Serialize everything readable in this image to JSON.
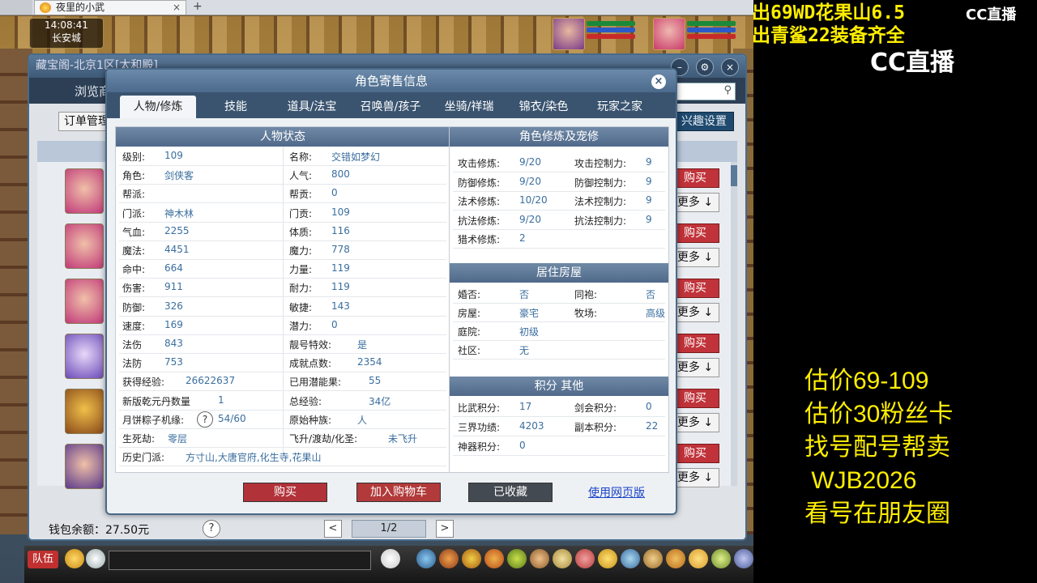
{
  "browser": {
    "tab_title": "夜里的小武",
    "tab_close": "×",
    "new_tab": "+"
  },
  "clock": {
    "time": "14:08:41",
    "location": "长安城"
  },
  "overlay": {
    "line1": "出69WD花果山6.5",
    "line2": "出青鲨22装备齐全",
    "cc_small": "CC直播",
    "cc_large": "CC直播",
    "right_lines": [
      "估价69-109",
      "估价30粉丝卡",
      "找号配号帮卖",
      " WJB2026",
      "看号在朋友圈"
    ]
  },
  "shop": {
    "title": "藏宝阁-北京1区[太和殿]",
    "nav_browse": "浏览商",
    "order_button": "订单管理",
    "interest_button": "兴趣设置",
    "buy_label": "购买",
    "more_label": "更多 ↓",
    "wallet": "钱包余额：27.50元",
    "help": "?",
    "page_prev": "<",
    "page_next": ">",
    "page_indicator": "1/2",
    "window_buttons": [
      "–",
      "⚙",
      "×"
    ]
  },
  "modal": {
    "title": "角色寄售信息",
    "close": "×",
    "tabs": [
      "人物/修炼",
      "技能",
      "道具/法宝",
      "召唤兽/孩子",
      "坐骑/祥瑞",
      "锦衣/染色",
      "玩家之家"
    ],
    "status_header": "人物状态",
    "status_left": [
      {
        "label": "级别:",
        "value": "109"
      },
      {
        "label": "角色:",
        "value": "剑侠客"
      },
      {
        "label": "帮派:",
        "value": ""
      },
      {
        "label": "门派:",
        "value": "神木林"
      },
      {
        "label": "气血:",
        "value": "2255"
      },
      {
        "label": "魔法:",
        "value": "4451"
      },
      {
        "label": "命中:",
        "value": "664"
      },
      {
        "label": "伤害:",
        "value": "911"
      },
      {
        "label": "防御:",
        "value": "326"
      },
      {
        "label": "速度:",
        "value": "169"
      },
      {
        "label": "法伤",
        "value": "843"
      },
      {
        "label": "法防",
        "value": "753"
      },
      {
        "label": "获得经验:",
        "value": "26622637"
      },
      {
        "label": "新版乾元丹数量",
        "value": "1"
      },
      {
        "label": "月饼粽子机缘:",
        "value": "54/60"
      },
      {
        "label": "生死劫:",
        "value": "零层"
      },
      {
        "label": "历史门派:",
        "value": "方寸山,大唐官府,化生寺,花果山"
      }
    ],
    "status_right": [
      {
        "label": "名称:",
        "value": "交错如梦幻"
      },
      {
        "label": "人气:",
        "value": "800"
      },
      {
        "label": "帮贡:",
        "value": "0"
      },
      {
        "label": "门贡:",
        "value": "109"
      },
      {
        "label": "体质:",
        "value": "116"
      },
      {
        "label": "魔力:",
        "value": "778"
      },
      {
        "label": "力量:",
        "value": "119"
      },
      {
        "label": "耐力:",
        "value": "119"
      },
      {
        "label": "敏捷:",
        "value": "143"
      },
      {
        "label": "潜力:",
        "value": "0"
      },
      {
        "label": "靓号特效:",
        "value": "是"
      },
      {
        "label": "成就点数:",
        "value": "2354"
      },
      {
        "label": "已用潜能果:",
        "value": "55"
      },
      {
        "label": "总经验:",
        "value": "34亿"
      },
      {
        "label": "原始种族:",
        "value": "人"
      },
      {
        "label": "飞升/渡劫/化圣:",
        "value": "未飞升"
      }
    ],
    "cultivation_header": "角色修炼及宠修",
    "cultivation": [
      {
        "label": "攻击修炼:",
        "value": "9/20",
        "label2": "攻击控制力:",
        "value2": "9"
      },
      {
        "label": "防御修炼:",
        "value": "9/20",
        "label2": "防御控制力:",
        "value2": "9"
      },
      {
        "label": "法术修炼:",
        "value": "10/20",
        "label2": "法术控制力:",
        "value2": "9"
      },
      {
        "label": "抗法修炼:",
        "value": "9/20",
        "label2": "抗法控制力:",
        "value2": "9"
      },
      {
        "label": "猎术修炼:",
        "value": "2",
        "label2": "",
        "value2": ""
      }
    ],
    "housing_header": "居住房屋",
    "housing": [
      {
        "label": "婚否:",
        "value": "否",
        "label2": "同袍:",
        "value2": "否"
      },
      {
        "label": "房屋:",
        "value": "豪宅",
        "label2": "牧场:",
        "value2": "高级"
      },
      {
        "label": "庭院:",
        "value": "初级",
        "label2": "",
        "value2": ""
      },
      {
        "label": "社区:",
        "value": "无",
        "label2": "",
        "value2": ""
      }
    ],
    "points_header": "积分 其他",
    "points": [
      {
        "label": "比武积分:",
        "value": "17",
        "label2": "剑会积分:",
        "value2": "0"
      },
      {
        "label": "三界功绩:",
        "value": "4203",
        "label2": "副本积分:",
        "value2": "22"
      },
      {
        "label": "神器积分:",
        "value": "0",
        "label2": "",
        "value2": ""
      }
    ],
    "buttons": {
      "buy": "购买",
      "add_cart": "加入购物车",
      "favorited": "已收藏",
      "web_version": "使用网页版"
    },
    "help": "?"
  },
  "toolbar": {
    "team": "队伍"
  },
  "colors": {
    "buy_red": "#c0333a",
    "cart_red": "#b23a3a",
    "fav_gray": "#444a52",
    "overlay_yellow": "#ffee00"
  }
}
